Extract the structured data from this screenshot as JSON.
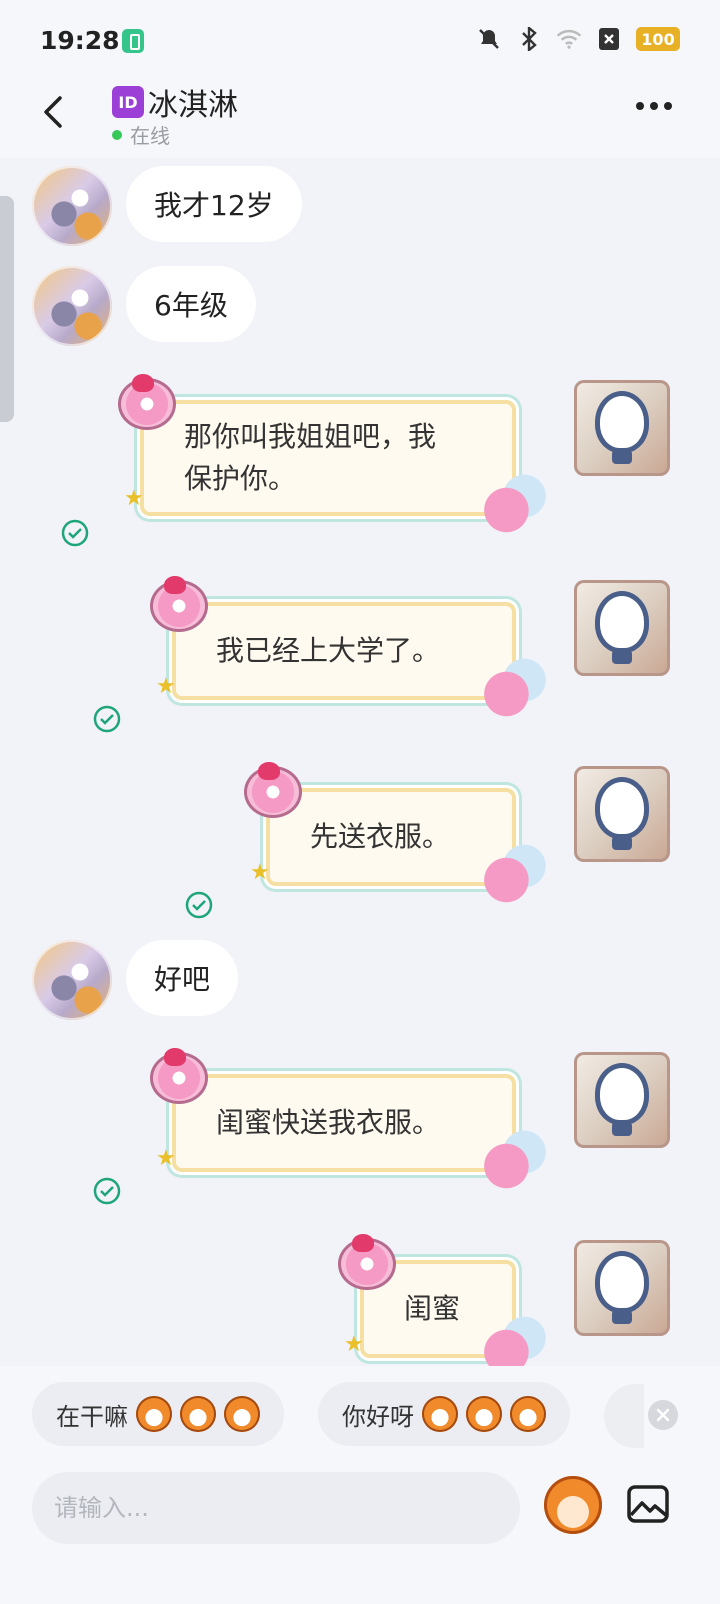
{
  "status_bar": {
    "time": "19:28",
    "battery": "100"
  },
  "header": {
    "id_badge": "ID",
    "title": "冰淇淋",
    "status": "在线"
  },
  "messages": [
    {
      "side": "in",
      "text": "我才12岁"
    },
    {
      "side": "in",
      "text": "6年级"
    },
    {
      "side": "out",
      "text": "那你叫我姐姐吧，我保护你。",
      "lines": [
        "那你叫我姐姐吧，我",
        "保护你。"
      ]
    },
    {
      "side": "out",
      "text": "我已经上大学了。"
    },
    {
      "side": "out",
      "text": "先送衣服。"
    },
    {
      "side": "in",
      "text": "好吧"
    },
    {
      "side": "out",
      "text": "闺蜜快送我衣服。"
    },
    {
      "side": "out",
      "text": "闺蜜"
    }
  ],
  "quick_replies": [
    {
      "text": "在干嘛"
    },
    {
      "text": "你好呀"
    }
  ],
  "composer": {
    "placeholder": "请输入..."
  },
  "colors": {
    "background": "#f1f3f8",
    "online": "#37c85a",
    "sent_check": "#1fa57a",
    "id_badge": "#9b3fd6"
  }
}
